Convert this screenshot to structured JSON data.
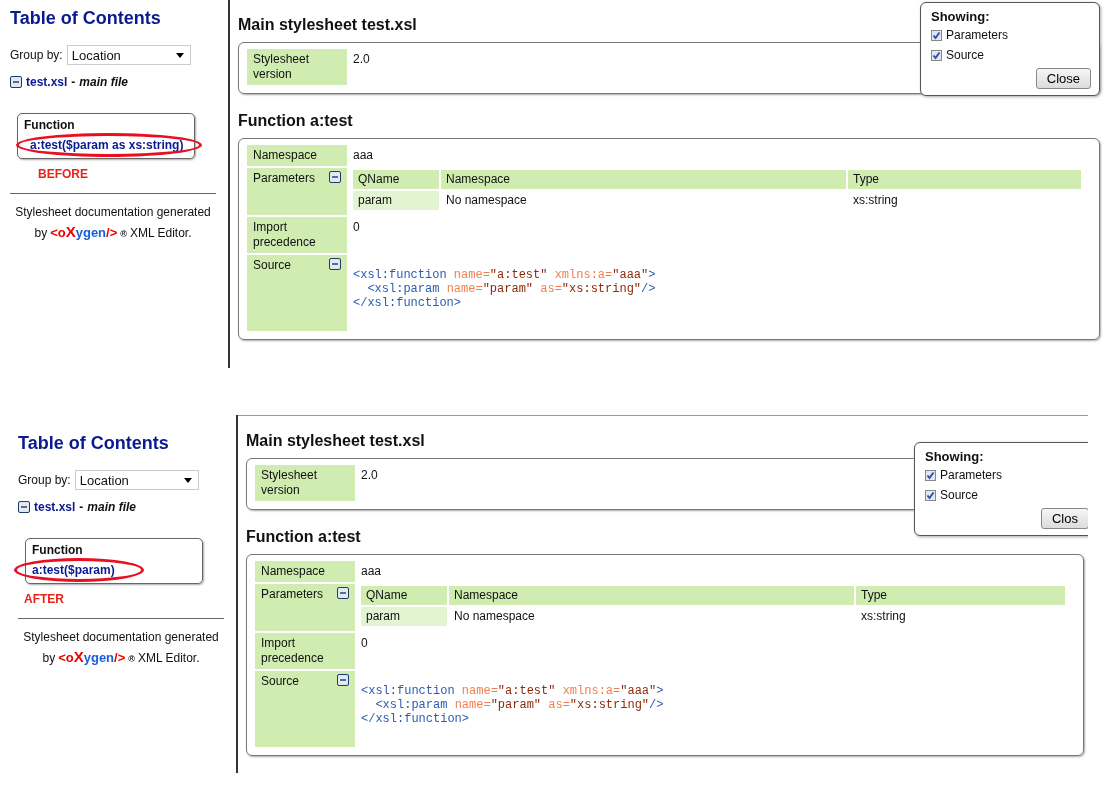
{
  "captures": [
    {
      "toc": {
        "title": "Table of Contents",
        "group_by_label": "Group by:",
        "group_by_value": "Location",
        "file_name": "test.xsl",
        "file_separator": "-",
        "file_suffix": "main file",
        "expanded": true,
        "item_kind": "Function",
        "item_signature": "a:test($param as xs:string)"
      },
      "annotation": "BEFORE",
      "footer": {
        "text": "Stylesheet documentation generated",
        "by": "by",
        "logo": [
          {
            "text": "<o",
            "color": "#ee0000"
          },
          {
            "text": "X",
            "color": "#ee0000"
          },
          {
            "text": "ygen",
            "color": "#1a5fd6"
          },
          {
            "text": "/>",
            "color": "#ee0000"
          }
        ],
        "mark": "®",
        "suffix": "XML Editor."
      },
      "main_heading": "Main stylesheet **test.xsl**",
      "version_label": "Stylesheet version",
      "version_value": "2.0",
      "function_heading": "Function a:test",
      "namespace_label": "Namespace",
      "namespace_value": "aaa",
      "parameters_label": "Parameters",
      "parameters_expanded": true,
      "param_columns": [
        "QName",
        "Namespace",
        "Type"
      ],
      "param_rows": [
        [
          "param",
          "No namespace",
          "xs:string"
        ]
      ],
      "precedence_label": "Import precedence",
      "precedence_value": "0",
      "source_label": "Source",
      "source_expanded": true,
      "source_lines": [
        [
          {
            "kind": "tag",
            "text": "<xsl:function "
          },
          {
            "kind": "attr",
            "text": "name="
          },
          {
            "kind": "value",
            "text": "\"a:test\" "
          },
          {
            "kind": "attr",
            "text": "xmlns:a="
          },
          {
            "kind": "value",
            "text": "\"aaa\""
          },
          {
            "kind": "tag",
            "text": ">"
          }
        ],
        [
          {
            "kind": "tag",
            "text": "  <xsl:param "
          },
          {
            "kind": "attr",
            "text": "name="
          },
          {
            "kind": "value",
            "text": "\"param\" "
          },
          {
            "kind": "attr",
            "text": "as="
          },
          {
            "kind": "value",
            "text": "\"xs:string\""
          },
          {
            "kind": "tag",
            "text": "/>"
          }
        ],
        [
          {
            "kind": "tag",
            "text": "</xsl:function>"
          }
        ]
      ],
      "popup": {
        "title": "Showing:",
        "options": [
          {
            "label": "Parameters",
            "checked": true
          },
          {
            "label": "Source",
            "checked": true
          }
        ],
        "close": "Close"
      }
    },
    {
      "toc": {
        "title": "Table of Contents",
        "group_by_label": "Group by:",
        "group_by_value": "Location",
        "file_name": "test.xsl",
        "file_separator": "-",
        "file_suffix": "main file",
        "expanded": true,
        "item_kind": "Function",
        "item_signature": "a:test($param)"
      },
      "annotation": "AFTER",
      "footer": {
        "text": "Stylesheet documentation generated",
        "by": "by",
        "logo": [
          {
            "text": "<o",
            "color": "#ee0000"
          },
          {
            "text": "X",
            "color": "#ee0000"
          },
          {
            "text": "ygen",
            "color": "#1a5fd6"
          },
          {
            "text": "/>",
            "color": "#ee0000"
          }
        ],
        "mark": "®",
        "suffix": "XML Editor."
      },
      "main_heading": "Main stylesheet **test.xsl**",
      "version_label": "Stylesheet version",
      "version_value": "2.0",
      "function_heading": "Function a:test",
      "namespace_label": "Namespace",
      "namespace_value": "aaa",
      "parameters_label": "Parameters",
      "parameters_expanded": true,
      "param_columns": [
        "QName",
        "Namespace",
        "Type"
      ],
      "param_rows": [
        [
          "param",
          "No namespace",
          "xs:string"
        ]
      ],
      "precedence_label": "Import precedence",
      "precedence_value": "0",
      "source_label": "Source",
      "source_expanded": true,
      "source_lines": [
        [
          {
            "kind": "tag",
            "text": "<xsl:function "
          },
          {
            "kind": "attr",
            "text": "name="
          },
          {
            "kind": "value",
            "text": "\"a:test\" "
          },
          {
            "kind": "attr",
            "text": "xmlns:a="
          },
          {
            "kind": "value",
            "text": "\"aaa\""
          },
          {
            "kind": "tag",
            "text": ">"
          }
        ],
        [
          {
            "kind": "tag",
            "text": "  <xsl:param "
          },
          {
            "kind": "attr",
            "text": "name="
          },
          {
            "kind": "value",
            "text": "\"param\" "
          },
          {
            "kind": "attr",
            "text": "as="
          },
          {
            "kind": "value",
            "text": "\"xs:string\""
          },
          {
            "kind": "tag",
            "text": "/>"
          }
        ],
        [
          {
            "kind": "tag",
            "text": "</xsl:function>"
          }
        ]
      ],
      "popup": {
        "title": "Showing:",
        "options": [
          {
            "label": "Parameters",
            "checked": true
          },
          {
            "label": "Source",
            "checked": true
          }
        ],
        "close": "Clos"
      }
    }
  ]
}
